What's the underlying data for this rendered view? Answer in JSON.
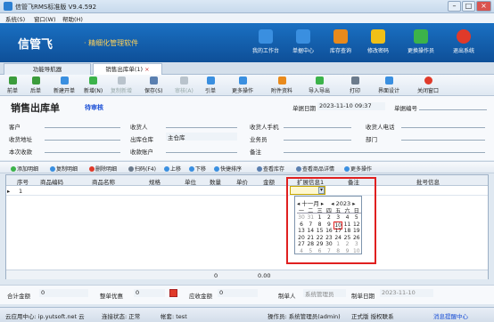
{
  "window": {
    "title": "信管飞RMS标准版 V9.4.592"
  },
  "menu": [
    "系统(S)",
    "窗口(W)",
    "帮助(H)"
  ],
  "banner": {
    "logo": "信管飞",
    "slogan": "· 精细化管理软件",
    "items": [
      "我的工作台",
      "单据中心",
      "库存查询",
      "修改密码",
      "更换操作员",
      "退出系统"
    ],
    "colors": [
      "#3a8fe0",
      "#3a8fe0",
      "#e98a1c",
      "#f0c018",
      "#3cb34a",
      "#e03a2a"
    ]
  },
  "tabs": [
    "功能导航器",
    "销售出库单(1)"
  ],
  "toolbar": [
    "前单",
    "后单",
    "新建开单",
    "新增(N)",
    "复制新增",
    "保存(S)",
    "审核(A)",
    "引单",
    "更多操作",
    "附件资料",
    "导入导出",
    "打印",
    "界面设计",
    "关闭窗口"
  ],
  "form": {
    "title": "销售出库单",
    "audit_status": "待审核",
    "date_label": "单据日期",
    "date_value": "2023-11-10 09:37",
    "no_label": "单据编号",
    "customer": "客户",
    "receiver": "收货人",
    "receiver_phone": "收货人手机",
    "receiver_tel": "收货人电话",
    "address": "收货地址",
    "warehouse_label": "出库仓库",
    "warehouse_value": "主仓库",
    "salesman": "业务员",
    "dept": "部门",
    "receipt": "本次收款",
    "account": "收款账户",
    "remark": "备注"
  },
  "subtoolbar": [
    "添加明细",
    "复制明细",
    "删除明细",
    "扫码(F4)",
    "上移",
    "下移",
    "快捷排序",
    "查看库存",
    "查看商品详情",
    "更多操作"
  ],
  "grid": {
    "headers": [
      "序号",
      "商品编码",
      "商品名称",
      "规格",
      "单位",
      "数量",
      "单价",
      "金额",
      "扩展信息1",
      "备注",
      "批号信息"
    ],
    "row_no": "1",
    "footer": [
      "0",
      "0.00"
    ]
  },
  "calendar": {
    "month": "十一月",
    "year": "2023",
    "weekdays": [
      "一",
      "二",
      "三",
      "四",
      "五",
      "六",
      "日"
    ],
    "rows": [
      [
        "30",
        "31",
        "1",
        "2",
        "3",
        "4",
        "5"
      ],
      [
        "6",
        "7",
        "8",
        "9",
        "10",
        "11",
        "12"
      ],
      [
        "13",
        "14",
        "15",
        "16",
        "17",
        "18",
        "19"
      ],
      [
        "20",
        "21",
        "22",
        "23",
        "24",
        "25",
        "26"
      ],
      [
        "27",
        "28",
        "29",
        "30",
        "1",
        "2",
        "3"
      ],
      [
        "4",
        "5",
        "6",
        "7",
        "8",
        "9",
        "10"
      ]
    ]
  },
  "totals": {
    "total_label": "合计金额",
    "total_value": "0",
    "discount_label": "整单优惠",
    "discount_value": "0",
    "receivable_label": "应收金额",
    "receivable_value": "0",
    "maker_label": "制单人",
    "maker_value": "系统管理员",
    "make_date_label": "制单日期",
    "make_date_value": "2023-11-10"
  },
  "status": {
    "cloud": "云应用中心: ip.yutsoft.net 云",
    "conn": "连接状态: 正常",
    "account": "帐套: test",
    "operator": "操作员: 系统管理员(admin)",
    "edition": "正式版 授权联系",
    "msg": "消息提醒中心"
  }
}
